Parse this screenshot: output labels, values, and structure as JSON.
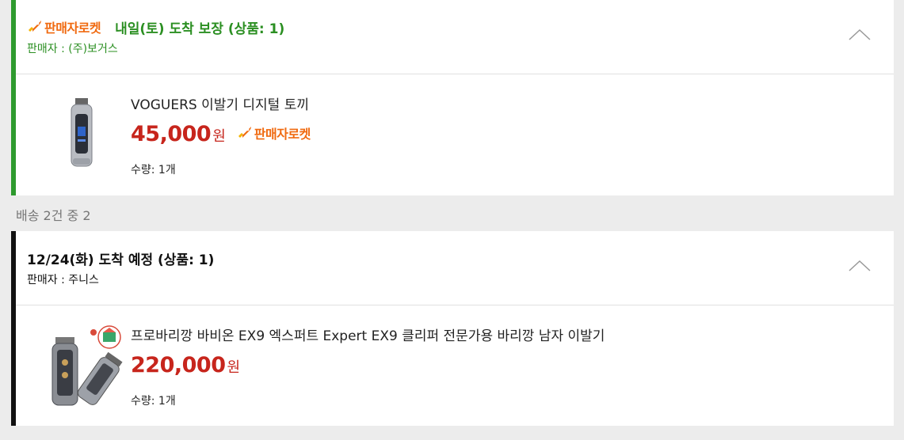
{
  "colors": {
    "green": "#2b8f22",
    "orange": "#f06a10",
    "price_red": "#c7251c"
  },
  "shipment1": {
    "rocket_label": "판매자로켓",
    "title": "내일(토) 도착 보장 (상품: 1)",
    "seller": "판매자 : (주)보거스",
    "item": {
      "name": "VOGUERS 이발기 디지털 토끼",
      "price": "45,000",
      "currency": "원",
      "rocket_badge": "판매자로켓",
      "quantity": "수량: 1개",
      "image_icon": "hair-clipper-image"
    }
  },
  "section_label": "배송 2건 중 2",
  "shipment2": {
    "title": "12/24(화) 도착 예정 (상품: 1)",
    "seller": "판매자 : 주니스",
    "item": {
      "name": "프로바리깡 바비온 EX9 엑스퍼트 Expert EX9 클리퍼 전문가용 바리깡 남자 이발기",
      "price": "220,000",
      "currency": "원",
      "quantity": "수량: 1개",
      "image_icon": "clipper-set-image"
    }
  }
}
